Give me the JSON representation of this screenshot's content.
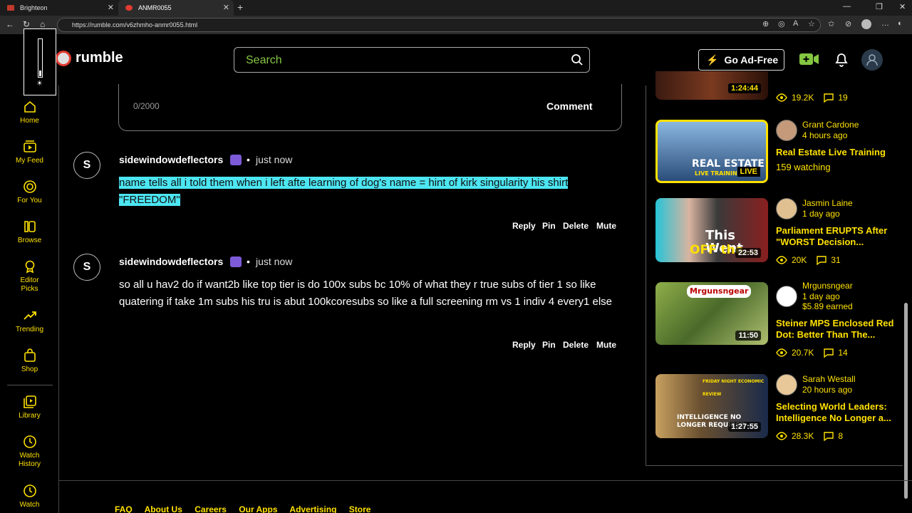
{
  "browser": {
    "tabs": [
      {
        "title": "Brighteon",
        "favicon_color": "#c0392b"
      },
      {
        "title": "ANMR0055",
        "favicon_color": "#e03c31"
      }
    ],
    "url": "https://rumble.com/v6zhmho-anmr0055.html"
  },
  "header": {
    "logo": "rumble",
    "search_placeholder": "Search",
    "ad_free": "Go Ad-Free",
    "brightness_level": 0.15
  },
  "sidebar": {
    "items": [
      {
        "label": "Home",
        "icon": "home-icon"
      },
      {
        "label": "My Feed",
        "icon": "feed-icon"
      },
      {
        "label": "For You",
        "icon": "target-icon"
      },
      {
        "label": "Browse",
        "icon": "library-icon"
      },
      {
        "label": "Editor Picks",
        "icon": "award-icon"
      },
      {
        "label": "Trending",
        "icon": "trending-icon"
      },
      {
        "label": "Shop",
        "icon": "bag-icon"
      },
      {
        "label": "Library",
        "icon": "play-list-icon"
      },
      {
        "label": "Watch History",
        "icon": "history-icon"
      },
      {
        "label": "Watch",
        "icon": "clock-icon"
      }
    ]
  },
  "comment_box": {
    "counter": "0/2000",
    "submit": "Comment"
  },
  "comments": [
    {
      "avatar": "S",
      "user": "sidewindowdeflectors",
      "time": "just now",
      "text": "name tells all i told them when i left afte learning of dog's name = hint of kirk singularity his shirt \"FREEDOM\"",
      "selected": true,
      "actions": [
        "Reply",
        "Pin",
        "Delete",
        "Mute"
      ]
    },
    {
      "avatar": "S",
      "user": "sidewindowdeflectors",
      "time": "just now",
      "text": "so all u hav2 do if want2b like top tier is do 100x subs bc 10% of what they r true subs of tier 1 so like quatering if take 1m subs his tru is abut 100kcoresubs so like a full screening rm vs 1 indiv 4 every1 else",
      "selected": false,
      "actions": [
        "Reply",
        "Pin",
        "Delete",
        "Mute"
      ]
    }
  ],
  "related": {
    "top_partial": {
      "duration": "1:24:44",
      "views": "19.2K",
      "comments": "19"
    },
    "videos": [
      {
        "channel": "Grant Cardone",
        "age": "4 hours ago",
        "title": "Real Estate Live Training",
        "stat": "159 watching",
        "badge": "LIVE",
        "thumb_text_1": "REAL ESTATE",
        "thumb_text_2": "LIVE TRAINING"
      },
      {
        "channel": "Jasmin Laine",
        "age": "1 day ago",
        "title": "Parliament ERUPTS After \"WORST Decision...",
        "views": "20K",
        "comments": "31",
        "duration": "22:53",
        "thumb_text_1": "This Went",
        "thumb_text_2": "OFF the..."
      },
      {
        "channel": "Mrgunsngear",
        "age": "1 day ago",
        "earned": "$5.89 earned",
        "title": "Steiner MPS Enclosed Red Dot: Better Than The...",
        "views": "20.7K",
        "comments": "14",
        "duration": "11:50",
        "thumb_text_1": "Mrgunsngear"
      },
      {
        "channel": "Sarah Westall",
        "age": "20 hours ago",
        "title": "Selecting World Leaders: Intelligence No Longer a...",
        "views": "28.3K",
        "comments": "8",
        "duration": "1:27:55",
        "thumb_text_1": "FRIDAY NIGHT ECONOMIC REVIEW",
        "thumb_text_2": "INTELLIGENCE NO LONGER REQUIRED"
      }
    ]
  },
  "footer": {
    "links": [
      "FAQ",
      "About Us",
      "Careers",
      "Our Apps",
      "Advertising",
      "Store"
    ]
  }
}
